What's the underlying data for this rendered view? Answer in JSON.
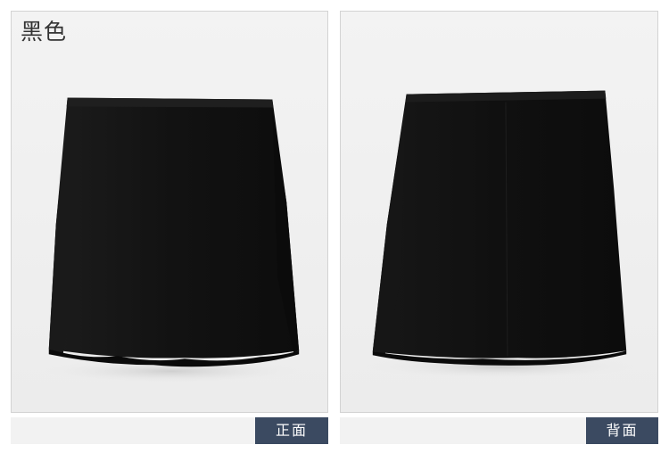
{
  "color": {
    "label": "黑色"
  },
  "views": [
    {
      "caption": "正面"
    },
    {
      "caption": "背面"
    }
  ],
  "colors": {
    "caption_bg": "#3b4a61",
    "panel_bg": "#f1f1f1",
    "skirt": "#111111"
  }
}
